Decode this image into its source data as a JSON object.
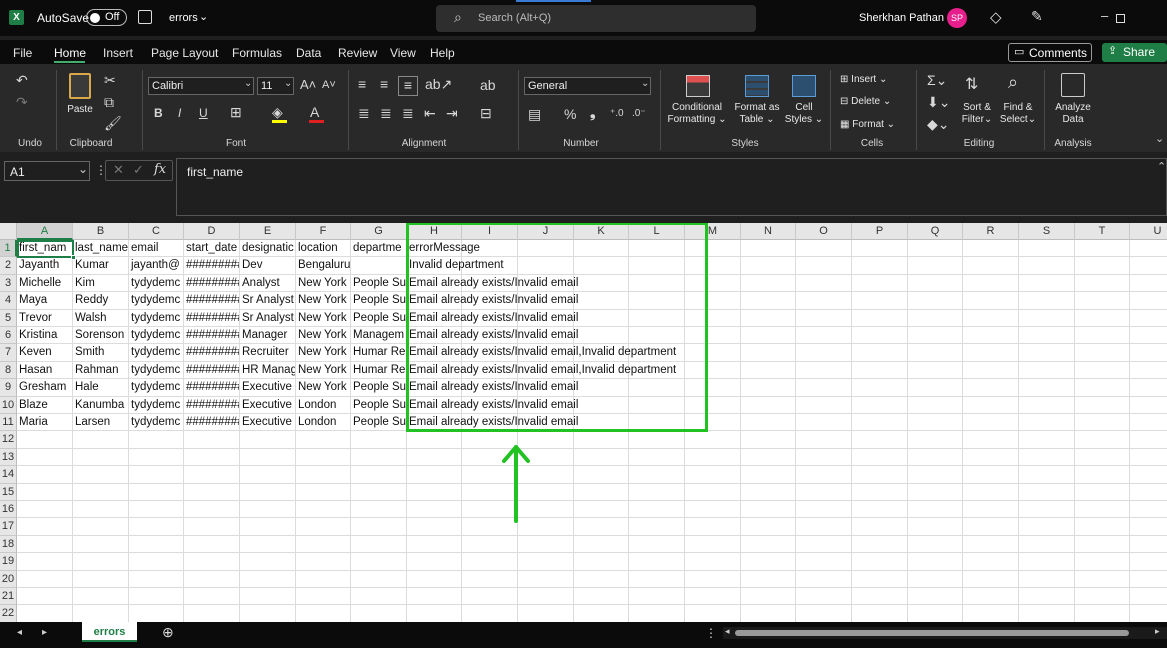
{
  "titlebar": {
    "autosave_label": "AutoSave",
    "autosave_state": "Off",
    "filename": "errors",
    "search_placeholder": "Search (Alt+Q)",
    "user_name": "Sherkhan Pathan",
    "user_initials": "SP",
    "accent_color": "#e81e8c"
  },
  "menu": {
    "items": [
      "File",
      "Home",
      "Insert",
      "Page Layout",
      "Formulas",
      "Data",
      "Review",
      "View",
      "Help"
    ],
    "active": "Home",
    "comments_label": "Comments",
    "share_label": "Share",
    "share_color": "#1e7e45"
  },
  "ribbon": {
    "groups": [
      "Undo",
      "Clipboard",
      "Font",
      "Alignment",
      "Number",
      "Styles",
      "Cells",
      "Editing",
      "Analysis"
    ],
    "paste_label": "Paste",
    "font_name": "Calibri",
    "font_size": "11",
    "number_format": "General",
    "conditional_formatting": [
      "Conditional",
      "Formatting"
    ],
    "format_as_table": [
      "Format as",
      "Table"
    ],
    "cell_styles": [
      "Cell",
      "Styles"
    ],
    "insert_label": "Insert",
    "delete_label": "Delete",
    "format_label": "Format",
    "sort_filter": [
      "Sort &",
      "Filter"
    ],
    "find_select": [
      "Find &",
      "Select"
    ],
    "analyze_data": [
      "Analyze",
      "Data"
    ]
  },
  "formula": {
    "name_box": "A1",
    "fx": "fx",
    "value": "first_name"
  },
  "sheet": {
    "columns": [
      "A",
      "B",
      "C",
      "D",
      "E",
      "F",
      "G",
      "H",
      "I",
      "J",
      "K",
      "L",
      "M",
      "N",
      "O",
      "P",
      "Q",
      "R",
      "S",
      "T",
      "U"
    ],
    "rows": [
      [
        "first_nam",
        "last_name",
        "email",
        "start_date",
        "designatic",
        "location",
        "departme",
        "errorMessage"
      ],
      [
        "Jayanth",
        "Kumar",
        "jayanth@",
        "#########",
        "Dev",
        "Bengaluru",
        "",
        "Invalid department"
      ],
      [
        "Michelle",
        "Kim",
        "tydydemc",
        "#########",
        "Analyst",
        "New York",
        "People Su",
        "Email already exists/Invalid email"
      ],
      [
        "Maya",
        "Reddy",
        "tydydemc",
        "#########",
        "Sr Analyst",
        "New York",
        "People Su",
        "Email already exists/Invalid email"
      ],
      [
        "Trevor",
        "Walsh",
        "tydydemc",
        "#########",
        "Sr Analyst",
        "New York",
        "People Su",
        "Email already exists/Invalid email"
      ],
      [
        "Kristina",
        "Sorenson",
        "tydydemc",
        "#########",
        "Manager",
        "New York",
        "Managem",
        "Email already exists/Invalid email"
      ],
      [
        "Keven",
        "Smith",
        "tydydemc",
        "#########",
        "Recruiter",
        "New York",
        "Humar Re",
        "Email already exists/Invalid email,Invalid department"
      ],
      [
        "Hasan",
        "Rahman",
        "tydydemc",
        "#########",
        "HR Manag",
        "New York",
        "Humar Re",
        "Email already exists/Invalid email,Invalid department"
      ],
      [
        "Gresham",
        "Hale",
        "tydydemc",
        "#########",
        "Executive",
        "New York",
        "People Su",
        "Email already exists/Invalid email"
      ],
      [
        "Blaze",
        "Kanumba",
        "tydydemc",
        "#########",
        "Executive",
        "London",
        "People Su",
        "Email already exists/Invalid email"
      ],
      [
        "Maria",
        "Larsen",
        "tydydemc",
        "#########",
        "Executive",
        "London",
        "People Su",
        "Email already exists/Invalid email"
      ]
    ],
    "row_numbers": [
      "1",
      "2",
      "3",
      "4",
      "5",
      "6",
      "7",
      "8",
      "9",
      "10",
      "11",
      "12",
      "13",
      "14",
      "15",
      "16",
      "17",
      "18",
      "19",
      "20",
      "21",
      "22"
    ],
    "tab_name": "errors",
    "highlight_color": "#22c222"
  }
}
